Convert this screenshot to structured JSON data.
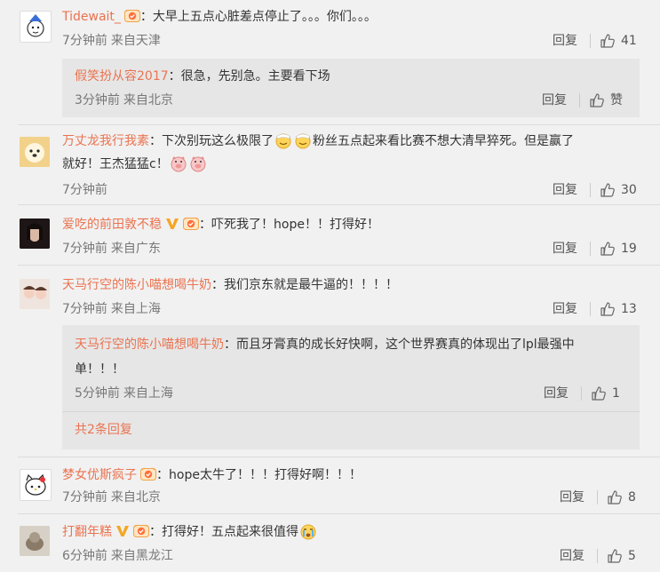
{
  "comments": [
    {
      "user": "Tidewait_",
      "text": "大早上五点心脏差点停止了。。。你们。。。",
      "time": "7分钟前",
      "from": "来自天津",
      "reply": "回复",
      "likes": "41",
      "avatar": "cartoon-avatar"
    },
    {
      "user": "万丈龙我行我素",
      "text": "下次别玩这么极限了",
      "text_mid": "粉丝五点起来看比赛不想大清早猝死。但是赢了",
      "text2": "就好！王杰猛猛c！",
      "time": "7分钟前",
      "reply": "回复",
      "likes": "30",
      "avatar": "dog-avatar"
    },
    {
      "user": "爱吃的前田敦不稳",
      "text": "吓死我了！hope！！打得好！",
      "time": "7分钟前",
      "from": "来自广东",
      "reply": "回复",
      "likes": "19",
      "avatar": "photo-avatar-dark"
    },
    {
      "user": "天马行空的陈小喵想喝牛奶",
      "text": "我们京东就是最牛逼的！！！！",
      "time": "7分钟前",
      "from": "来自上海",
      "reply": "回复",
      "likes": "13",
      "avatar": "photo-avatar-girl"
    },
    {
      "user": "梦女优斯疯子",
      "text": "hope太牛了！！！打得好啊！！！",
      "time": "7分钟前",
      "from": "来自北京",
      "reply": "回复",
      "likes": "8",
      "avatar": "hello-kitty-avatar"
    },
    {
      "user": "打翻年糕",
      "text": "打得好！五点起来很值得",
      "time": "6分钟前",
      "from": "来自黑龙江",
      "reply": "回复",
      "likes": "5",
      "avatar": "photo-avatar-cat"
    }
  ],
  "replies": {
    "r1": {
      "user": "假笑扮从容2017",
      "text": "很急，先别急。主要看下场",
      "time": "3分钟前",
      "from": "来自北京",
      "reply": "回复",
      "likes": "赞"
    },
    "r4": {
      "user": "天马行空的陈小喵想喝牛奶",
      "text": "而且牙膏真的成长好快啊，这个世界赛真的体现出了lpl最强中",
      "text2": "单！！！",
      "time": "5分钟前",
      "from": "来自上海",
      "reply": "回复",
      "likes": "1",
      "more": "共2条回复"
    }
  },
  "colors": {
    "username": "#eb7350",
    "background": "#f1f1f1",
    "reply_bg": "#e6e6e6"
  }
}
